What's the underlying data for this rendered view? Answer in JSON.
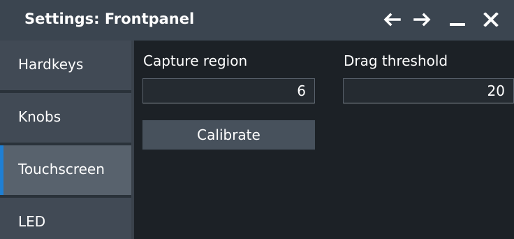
{
  "window": {
    "title": "Settings: Frontpanel",
    "controls": [
      {
        "name": "back-arrow-icon"
      },
      {
        "name": "forward-arrow-icon"
      },
      {
        "name": "minimize-icon"
      },
      {
        "name": "close-icon"
      }
    ]
  },
  "sidebar": {
    "items": [
      {
        "label": "Hardkeys",
        "active": false
      },
      {
        "label": "Knobs",
        "active": false
      },
      {
        "label": "Touchscreen",
        "active": true
      },
      {
        "label": "LED",
        "active": false
      }
    ]
  },
  "touchscreen": {
    "capture_region": {
      "label": "Capture region",
      "value": "6"
    },
    "drag_threshold": {
      "label": "Drag threshold",
      "value": "20"
    },
    "calibrate_label": "Calibrate"
  },
  "colors": {
    "accent": "#1f7fd3",
    "titlebar": "#3b4550",
    "background": "#1c2126"
  }
}
